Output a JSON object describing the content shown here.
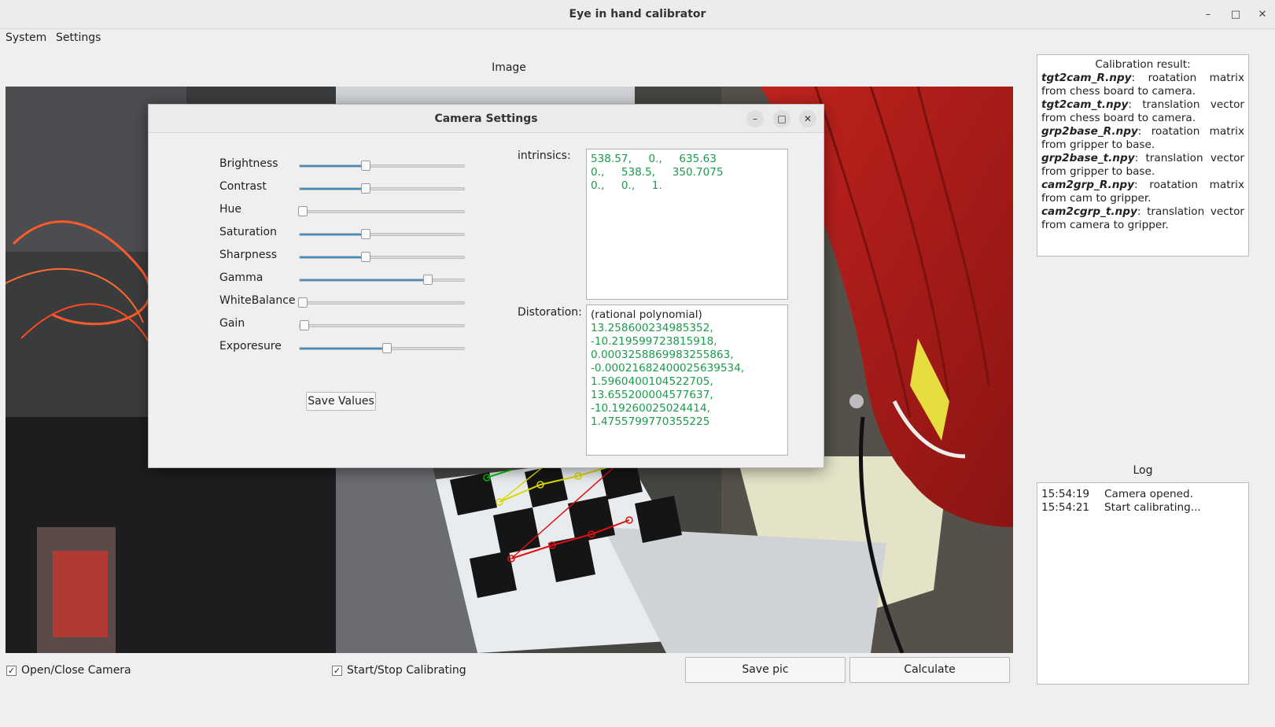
{
  "window": {
    "title": "Eye in hand calibrator",
    "minimize_glyph": "–",
    "maximize_glyph": "□",
    "close_glyph": "✕"
  },
  "menu": [
    "System",
    "Settings"
  ],
  "image_section": {
    "label": "Image"
  },
  "calibration": {
    "title": "Calibration result:",
    "entries": [
      {
        "file": "tgt2cam_R.npy",
        "desc": ": roatation matrix from chess board to camera."
      },
      {
        "file": "tgt2cam_t.npy",
        "desc": ": translation vector from chess board to camera."
      },
      {
        "file": "grp2base_R.npy",
        "desc": ": roatation matrix from gripper to base."
      },
      {
        "file": "grp2base_t.npy",
        "desc": ": translation vector from gripper to base."
      },
      {
        "file": "cam2grp_R.npy",
        "desc": ": roatation matrix from cam to gripper."
      },
      {
        "file": "cam2cgrp_t.npy",
        "desc": ": translation vector from camera to gripper."
      }
    ]
  },
  "log": {
    "label": "Log",
    "entries": [
      {
        "time": "15:54:19",
        "message": "Camera opened."
      },
      {
        "time": "15:54:21",
        "message": "Start calibrating..."
      }
    ]
  },
  "controls": {
    "open_close_camera": {
      "label": "Open/Close Camera",
      "checked": true
    },
    "start_stop_calibrating": {
      "label": "Start/Stop Calibrating",
      "checked": true
    },
    "save_pic": "Save pic",
    "calculate": "Calculate",
    "check_glyph": "✓"
  },
  "camera_settings": {
    "title": "Camera Settings",
    "minimize_glyph": "–",
    "maximize_glyph": "□",
    "close_glyph": "✕",
    "sliders": [
      {
        "label": "Brightness",
        "value": 0.4
      },
      {
        "label": "Contrast",
        "value": 0.4
      },
      {
        "label": "Hue",
        "value": 0.02
      },
      {
        "label": "Saturation",
        "value": 0.4
      },
      {
        "label": "Sharpness",
        "value": 0.4
      },
      {
        "label": "Gamma",
        "value": 0.78
      },
      {
        "label": "WhiteBalance",
        "value": 0.02
      },
      {
        "label": "Gain",
        "value": 0.03
      },
      {
        "label": "Exporesure",
        "value": 0.53
      }
    ],
    "save_values": "Save Values",
    "intrinsics_label": "intrinsics:",
    "intrinsics_lines": [
      "538.57,     0.,     635.63",
      "0.,     538.5,     350.7075",
      "0.,     0.,     1."
    ],
    "distortion_label": "Distoration:",
    "distortion_header": "(rational polynomial)",
    "distortion_lines": [
      "13.258600234985352,",
      "-10.219599723815918,",
      "0.0003258869983255863,",
      "-0.00021682400025639534,",
      "1.5960400104522705,",
      "13.655200004577637,",
      "-10.19260025024414,",
      "1.4755799770355225"
    ]
  }
}
